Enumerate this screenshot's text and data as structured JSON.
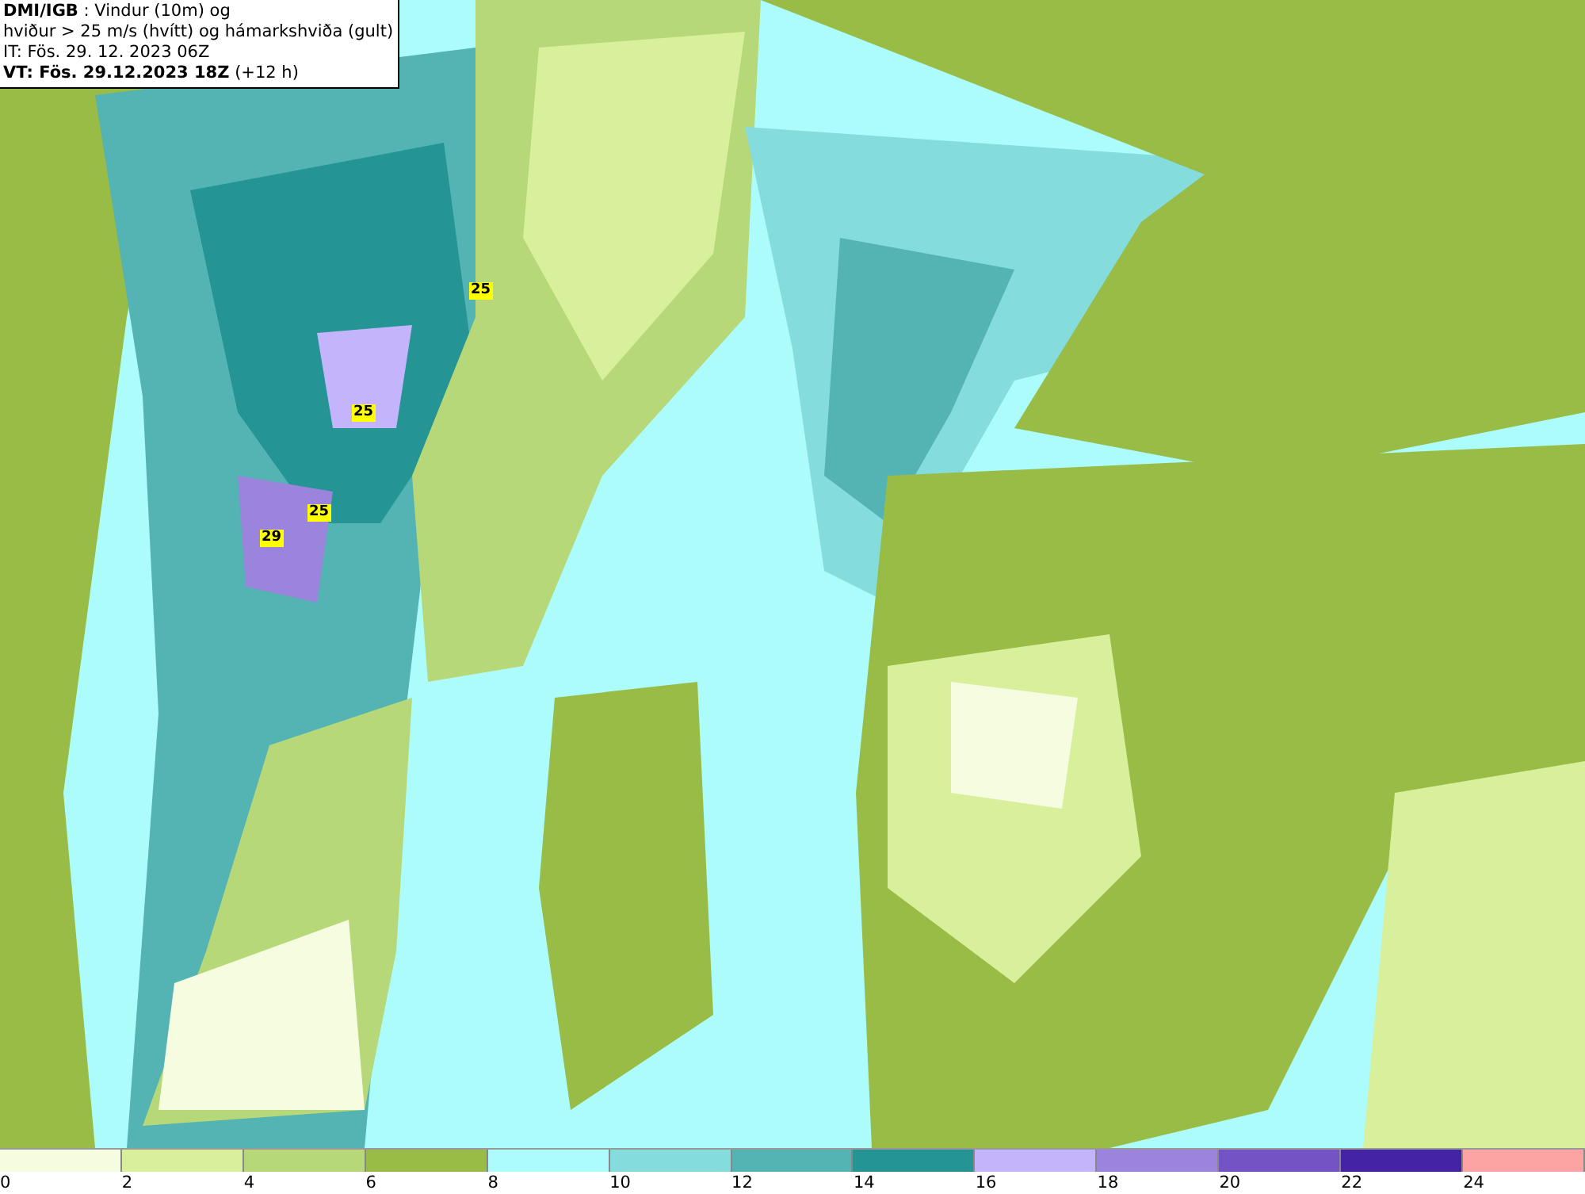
{
  "header": {
    "lines": [
      "**DMI/IGB** : Vindur (10m) og",
      "hviður > 25 m/s (hvítt) og hámarkshviða (gult)",
      "IT: Fös. 29. 12. 2023 06Z",
      "**VT: Fös. 29.12.2023 18Z** (+12 h)"
    ]
  },
  "map": {
    "gust_labels": [
      "25",
      "25",
      "25",
      "29"
    ]
  },
  "legend": {
    "bins": [
      {
        "label": "0",
        "color": "#f5fce0"
      },
      {
        "label": "2",
        "color": "#d8f09c"
      },
      {
        "label": "4",
        "color": "#b7d878"
      },
      {
        "label": "6",
        "color": "#99bc46"
      },
      {
        "label": "8",
        "color": "#adfcfc"
      },
      {
        "label": "10",
        "color": "#84dcdc"
      },
      {
        "label": "12",
        "color": "#54b4b4"
      },
      {
        "label": "14",
        "color": "#249494"
      },
      {
        "label": "16",
        "color": "#c4b4fc"
      },
      {
        "label": "18",
        "color": "#9a84dc"
      },
      {
        "label": "20",
        "color": "#7454c4"
      },
      {
        "label": "22",
        "color": "#4424a4"
      },
      {
        "label": "24",
        "color": "#fca4a4"
      }
    ]
  }
}
